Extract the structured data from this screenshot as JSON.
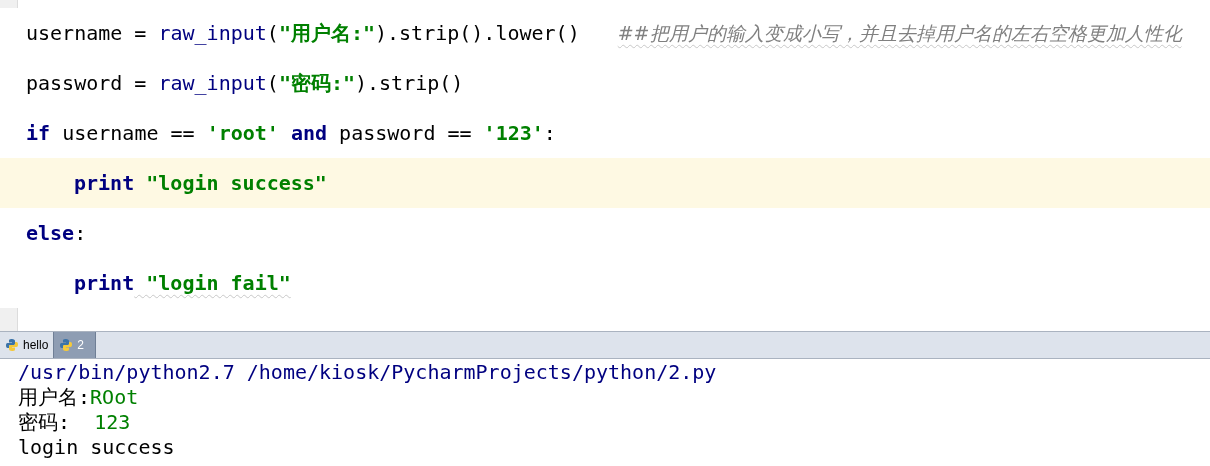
{
  "editor": {
    "lines": [
      {
        "current": false,
        "tokens": [
          {
            "text": "username = ",
            "kind": "plain"
          },
          {
            "text": "raw_input",
            "kind": "builtin"
          },
          {
            "text": "(",
            "kind": "plain"
          },
          {
            "text": "\"用户名:\"",
            "kind": "string"
          },
          {
            "text": ").strip().lower()",
            "kind": "plain"
          }
        ],
        "comment": {
          "text": "##把用户的输入变成小写，并且去掉用户名的左右空格更加人性化",
          "typo": true
        }
      },
      {
        "current": false,
        "tokens": [
          {
            "text": "password = ",
            "kind": "plain"
          },
          {
            "text": "raw_input",
            "kind": "builtin"
          },
          {
            "text": "(",
            "kind": "plain"
          },
          {
            "text": "\"密码:\"",
            "kind": "string"
          },
          {
            "text": ").strip()",
            "kind": "plain"
          }
        ]
      },
      {
        "current": false,
        "tokens": [
          {
            "text": "if",
            "kind": "keyword"
          },
          {
            "text": " username == ",
            "kind": "plain"
          },
          {
            "text": "'root'",
            "kind": "string"
          },
          {
            "text": " and",
            "kind": "keyword"
          },
          {
            "text": " password == ",
            "kind": "plain"
          },
          {
            "text": "'123'",
            "kind": "string"
          },
          {
            "text": ":",
            "kind": "plain"
          }
        ],
        "children": [
          {
            "current": true,
            "tokens": [
              {
                "text": "print",
                "kind": "keyword"
              },
              {
                "text": " \"login success\"",
                "kind": "string"
              }
            ]
          }
        ]
      },
      {
        "current": false,
        "tokens": [
          {
            "text": "else",
            "kind": "keyword"
          },
          {
            "text": ":",
            "kind": "plain"
          }
        ],
        "children": [
          {
            "current": false,
            "tokens": [
              {
                "text": "print",
                "kind": "keyword"
              },
              {
                "text": " \"login fail\"",
                "kind": "string",
                "typo": true
              }
            ]
          }
        ]
      }
    ]
  },
  "run_tabs": [
    {
      "label": "hello",
      "selected": false
    },
    {
      "label": "2",
      "selected": true
    }
  ],
  "console": {
    "lines": [
      {
        "tokens": [
          {
            "text": "/usr/bin/python2.7 /home/kiosk/PycharmProjects/python/2.py",
            "kind": "system"
          }
        ]
      },
      {
        "tokens": [
          {
            "text": "用户名:",
            "kind": "output"
          },
          {
            "text": "ROot",
            "kind": "input"
          }
        ]
      },
      {
        "tokens": [
          {
            "text": "密码:  ",
            "kind": "output"
          },
          {
            "text": "123",
            "kind": "input"
          }
        ]
      },
      {
        "tokens": [
          {
            "text": "login success",
            "kind": "output"
          }
        ]
      }
    ]
  }
}
